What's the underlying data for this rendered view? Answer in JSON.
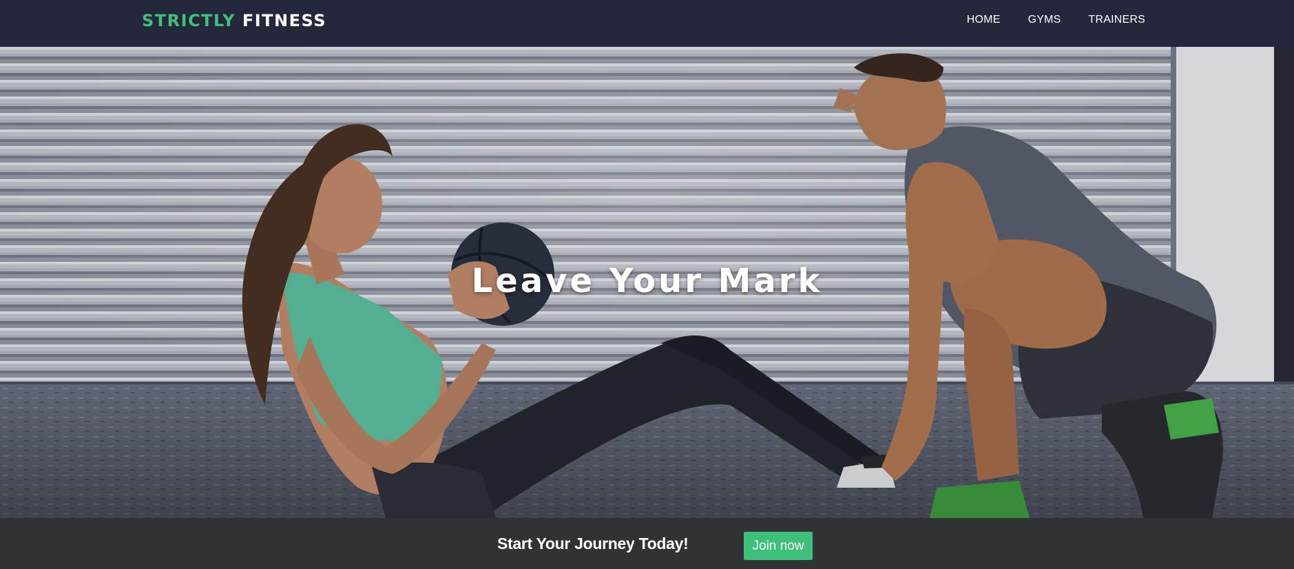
{
  "brand": {
    "part1": "STRICTLY",
    "part2": "FITNESS"
  },
  "nav": {
    "links": [
      {
        "label": "HOME"
      },
      {
        "label": "GYMS"
      },
      {
        "label": "TRAINERS"
      }
    ]
  },
  "hero": {
    "title": "Leave Your Mark",
    "image": "photo of a woman doing a medicine-ball sit-up while a male trainer holds her feet"
  },
  "cta": {
    "text": "Start Your Journey Today!",
    "button_label": "Join now"
  },
  "colors": {
    "navbar": "#24283a",
    "accent": "#3ec07a",
    "cta_bar": "#313235",
    "text": "#ffffff"
  }
}
